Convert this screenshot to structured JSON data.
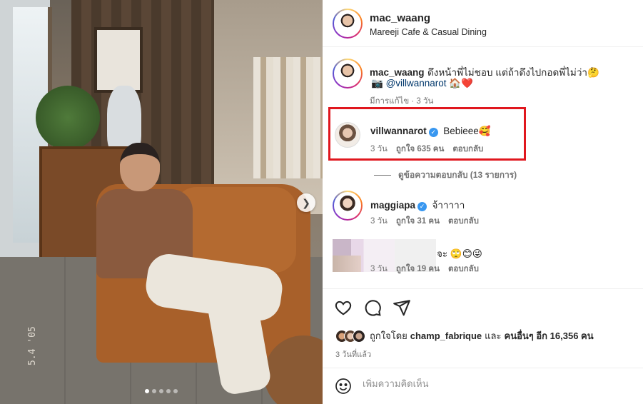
{
  "photo": {
    "date_stamp": "5.4 '05",
    "carousel": {
      "total": 5,
      "current": 1
    },
    "next_icon": "chevron-right-icon"
  },
  "header": {
    "username": "mac_waang",
    "location": "Mareeji Cafe & Casual Dining"
  },
  "caption": {
    "username": "mac_waang",
    "text": "ดึงหน้าพี่ไม่ชอบ แต่ถ้าดึงไปกอดพี่ไม่ว่า🤔",
    "line2_prefix": "📷 ",
    "mention": "@villwannarot",
    "line2_suffix": " 🏠❤️",
    "meta": "มีการแก้ไข · 3 วัน"
  },
  "comments": [
    {
      "username": "villwannarot",
      "verified": true,
      "text": "Bebieee🥰",
      "time": "3 วัน",
      "likes": "ถูกใจ 635 คน",
      "reply": "ตอบกลับ",
      "view_replies": "ดูข้อความตอบกลับ (13 รายการ)"
    },
    {
      "username": "maggiapa",
      "verified": true,
      "text": "จ้าาาาา",
      "time": "3 วัน",
      "likes": "ถูกใจ 31 คน",
      "reply": "ตอบกลับ"
    },
    {
      "username": "",
      "text": "จะ 🙄😊😜",
      "time": "3 วัน",
      "likes": "ถูกใจ 19 คน",
      "reply": "ตอบกลับ"
    }
  ],
  "actions": {
    "like_icon": "heart-icon",
    "comment_icon": "comment-icon",
    "share_icon": "send-icon"
  },
  "likes_summary": {
    "prefix": "ถูกใจโดย ",
    "user": "champ_fabrique",
    "middle": " และ",
    "others": "คนอื่นๆ อีก 16,356 คน"
  },
  "posted": "3 วันที่แล้ว",
  "add_comment": {
    "placeholder": "เพิ่มความคิดเห็น",
    "emoji_icon": "smiley-icon"
  },
  "colors": {
    "highlight_border": "#e0171e",
    "verified": "#3897f0",
    "like_heart": "#ed4956"
  }
}
